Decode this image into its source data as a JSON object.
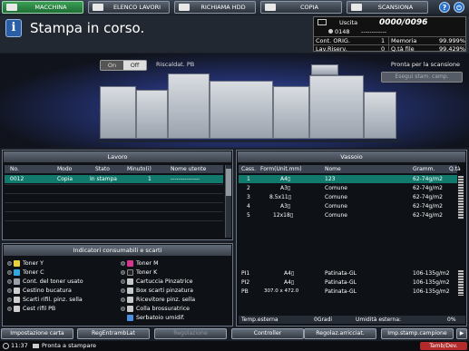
{
  "tabs": [
    {
      "label": "MACCHINA",
      "icon": "machine-icon",
      "active": true
    },
    {
      "label": "ELENCO LAVORI",
      "icon": "job-list-icon",
      "active": false
    },
    {
      "label": "RICHIAMA HDD",
      "icon": "hdd-icon",
      "active": false
    },
    {
      "label": "COPIA",
      "icon": "copy-icon",
      "active": false
    },
    {
      "label": "SCANSIONA",
      "icon": "scan-icon",
      "active": false
    }
  ],
  "top_right": {
    "help_glyph": "?",
    "power_glyph": "⏻"
  },
  "status": {
    "message": "Stampa in corso."
  },
  "counter": {
    "uscita_label": "Uscita",
    "uscita_value": "0000/0096",
    "user_count": "0148",
    "user_dashes": "------------",
    "cont_orig_label": "Cont. ORIG.",
    "cont_orig_value": "1",
    "memoria_label": "Memoria",
    "memoria_value": "99.999%",
    "lav_riserv_label": "Lav.Riserv.",
    "lav_riserv_value": "0",
    "qta_file_label": "Q.tà file",
    "qta_file_value": "99.429%"
  },
  "machine": {
    "toggle_on": "On",
    "toggle_off": "Off",
    "heat_label": "Riscaldat. PB",
    "ready_label": "Pronta per la scansione",
    "scan_button": "Esegui stam. camp."
  },
  "lavoro": {
    "title": "Lavoro",
    "columns": [
      "No.",
      "Modo",
      "Stato",
      "Minuto(i)",
      "Nome utente"
    ],
    "rows": [
      {
        "no": "0012",
        "modo": "Copia",
        "stato": "In stampa",
        "minuti": "1",
        "utente": "---------------"
      }
    ]
  },
  "consumabili": {
    "title": "Indicatori consumabili e scarti",
    "left": [
      {
        "label": "Toner Y",
        "color": "#e8d43a"
      },
      {
        "label": "Toner C",
        "color": "#2fa9e0"
      },
      {
        "label": "Cont. del toner usato",
        "color": "#9aa0a8"
      },
      {
        "label": "Cestino bucatura",
        "color": "#cfcfcf"
      },
      {
        "label": "Scarti rifil. pinz. sella",
        "color": "#cfcfcf"
      },
      {
        "label": "Cest rifil PB",
        "color": "#cfcfcf"
      }
    ],
    "right": [
      {
        "label": "Toner M",
        "color": "#d7368f"
      },
      {
        "label": "Toner K",
        "color": "#222222"
      },
      {
        "label": "Cartuccia Pinzatrice",
        "color": "#c8c8c8"
      },
      {
        "label": "Box scarti pinzatura",
        "color": "#c8c8c8"
      },
      {
        "label": "Ricevitore pinz. sella",
        "color": "#c8c8c8"
      },
      {
        "label": "Colla brossuratrice",
        "color": "#c8c8c8"
      },
      {
        "label": "Serbatoio umidif.",
        "color": "#4a8fe0"
      }
    ]
  },
  "vassoio": {
    "title": "Vassoio",
    "columns": [
      "Cass.",
      "Form(Unit.mm)",
      "Nome",
      "Gramm.",
      "Q.tà"
    ],
    "rows": [
      {
        "cass": "1",
        "form": "A4▯",
        "nome": "123",
        "gramm": "62-74g/m2"
      },
      {
        "cass": "2",
        "form": "A3▯",
        "nome": "Comune",
        "gramm": "62-74g/m2"
      },
      {
        "cass": "3",
        "form": "8.5x11▯",
        "nome": "Comune",
        "gramm": "62-74g/m2"
      },
      {
        "cass": "4",
        "form": "A3▯",
        "nome": "Comune",
        "gramm": "62-74g/m2"
      },
      {
        "cass": "5",
        "form": "12x18▯",
        "nome": "Comune",
        "gramm": "62-74g/m2"
      }
    ],
    "extra_rows": [
      {
        "cass": "PI1",
        "form": "A4▯",
        "nome": "Patinata-GL",
        "gramm": "106-135g/m2"
      },
      {
        "cass": "PI2",
        "form": "A4▯",
        "nome": "Patinata-GL",
        "gramm": "106-135g/m2"
      },
      {
        "cass": "PB",
        "form": "307.0 x 472.0",
        "nome": "Patinata-GL",
        "gramm": "106-135g/m2"
      }
    ],
    "temp_label": "Temp.esterna",
    "temp_value": "0Gradi",
    "umid_label": "Umidità esterna:",
    "umid_value": "0%"
  },
  "bottom_buttons": [
    {
      "label": "Impostazione carta",
      "enabled": true
    },
    {
      "label": "RegEntrambLat",
      "enabled": true
    },
    {
      "label": "Regolazione",
      "enabled": false
    },
    {
      "label": "Controller",
      "enabled": true
    },
    {
      "label": "Regolaz.arricciat.",
      "enabled": true
    },
    {
      "label": "Imp.stamp.campione",
      "enabled": true
    }
  ],
  "footer": {
    "time": "11:37",
    "message": "Pronta a stampare",
    "right_label": "Tamb/Dev."
  }
}
